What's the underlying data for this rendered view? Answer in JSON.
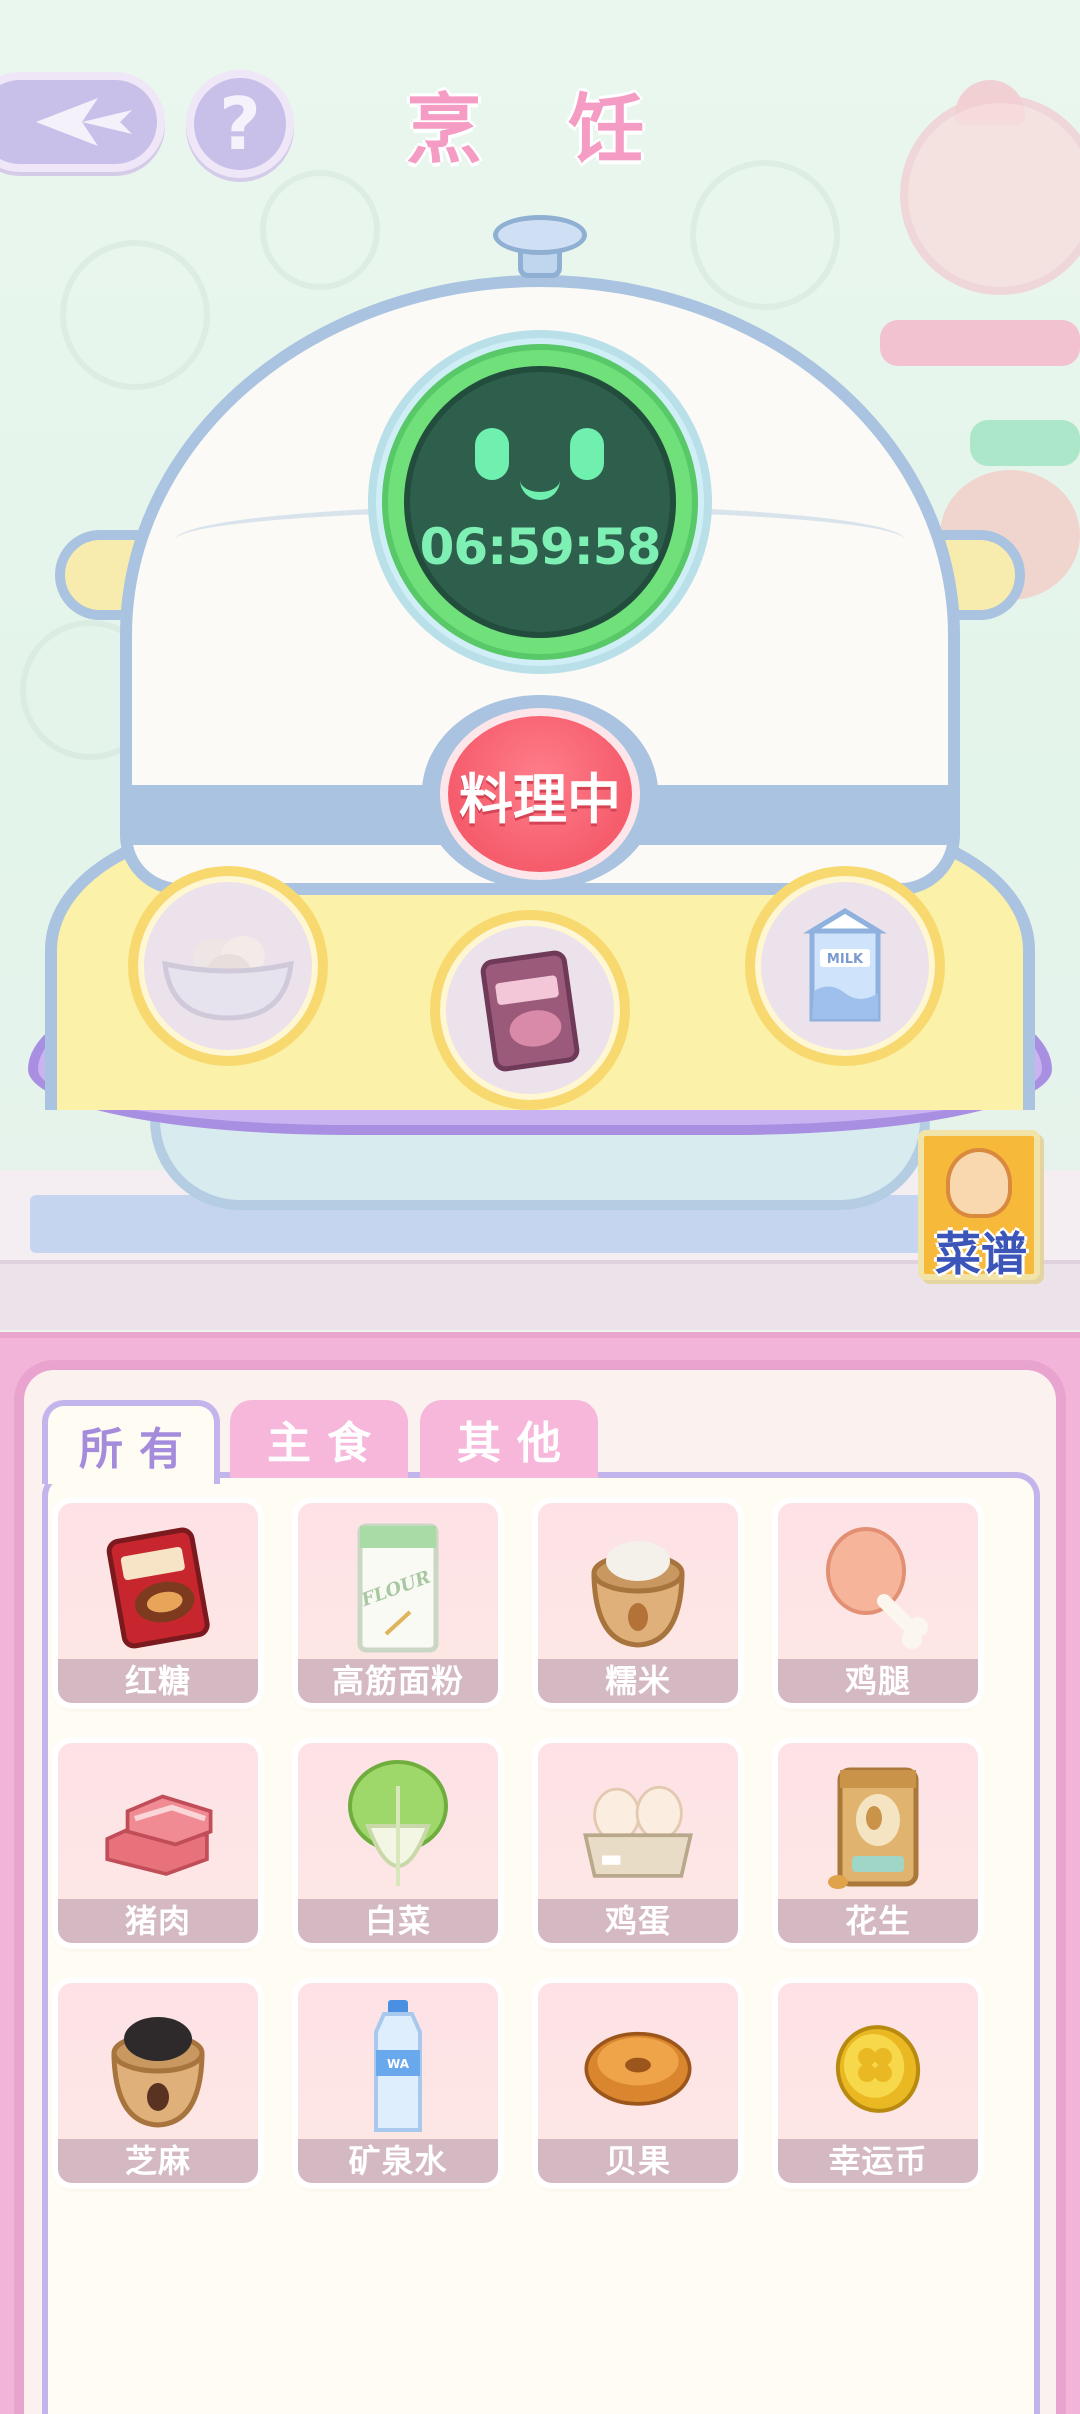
{
  "header": {
    "title": "烹 饪",
    "back_icon": "back-arrow-icon",
    "help_symbol": "?"
  },
  "cooker": {
    "timer": "06:59:58",
    "status_button": "料理中",
    "face": "smiley"
  },
  "slots": [
    {
      "name": "eggs-in-bowl"
    },
    {
      "name": "brown-sugar-bag"
    },
    {
      "name": "milk-carton"
    }
  ],
  "recipe_book": {
    "label": "菜谱"
  },
  "tabs": [
    {
      "label": "所有",
      "active": true
    },
    {
      "label": "主食",
      "active": false
    },
    {
      "label": "其他",
      "active": false
    }
  ],
  "items": [
    {
      "label": "红糖",
      "icon": "brown-sugar"
    },
    {
      "label": "高筋面粉",
      "icon": "flour"
    },
    {
      "label": "糯米",
      "icon": "rice-sack"
    },
    {
      "label": "鸡腿",
      "icon": "chicken-leg"
    },
    {
      "label": "猪肉",
      "icon": "pork"
    },
    {
      "label": "白菜",
      "icon": "cabbage"
    },
    {
      "label": "鸡蛋",
      "icon": "eggs"
    },
    {
      "label": "花生",
      "icon": "peanut-bag"
    },
    {
      "label": "芝麻",
      "icon": "sesame-sack"
    },
    {
      "label": "矿泉水",
      "icon": "water-bottle"
    },
    {
      "label": "贝果",
      "icon": "bagel"
    },
    {
      "label": "幸运币",
      "icon": "lucky-coin"
    }
  ],
  "colors": {
    "title": "#f49cc4",
    "timer": "#7ff0b4",
    "cook_button": "#f55c6c",
    "tab_active_text": "#a58bdc",
    "panel": "#f2b4d9"
  }
}
